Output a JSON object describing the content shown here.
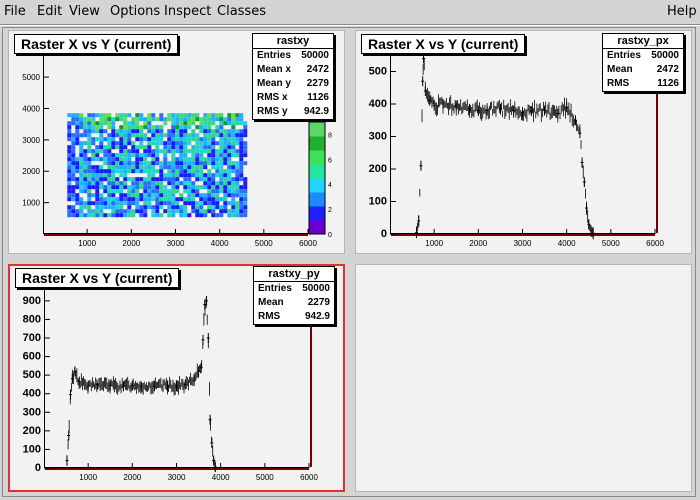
{
  "menu": {
    "file": "File",
    "edit": "Edit",
    "view": "View",
    "options": "Options",
    "inspect": "Inspect",
    "classes": "Classes",
    "help": "Help"
  },
  "colors": {
    "active_pad_border": "#e03030",
    "frame_shadow": "#7a0000",
    "pad_bg": "#f2f2f2"
  },
  "pads": {
    "p1": {
      "title": "Raster X vs Y (current)",
      "stats": {
        "name": "rastxy",
        "rows": [
          [
            "Entries",
            "50000"
          ],
          [
            "Mean x",
            "2472"
          ],
          [
            "Mean y",
            "2279"
          ],
          [
            "RMS x",
            "1126"
          ],
          [
            "RMS y",
            "942.9"
          ]
        ]
      }
    },
    "p2": {
      "title": "Raster X vs Y (current)",
      "stats": {
        "name": "rastxy_px",
        "rows": [
          [
            "Entries",
            "50000"
          ],
          [
            "Mean",
            "2472"
          ],
          [
            "RMS",
            "1126"
          ]
        ]
      }
    },
    "p3": {
      "title": "Raster X vs Y (current)",
      "stats": {
        "name": "rastxy_py",
        "rows": [
          [
            "Entries",
            "50000"
          ],
          [
            "Mean",
            "2279"
          ],
          [
            "RMS",
            "942.9"
          ]
        ]
      }
    }
  },
  "chart_data": [
    {
      "type": "heatmap",
      "title": "Raster X vs Y (current)",
      "x_ticks": [
        "1000",
        "2000",
        "3000",
        "4000",
        "5000",
        "6000"
      ],
      "y_ticks": [
        "1000",
        "2000",
        "3000",
        "4000",
        "5000"
      ],
      "xlim": [
        0,
        6000
      ],
      "ylim": [
        0,
        5800
      ],
      "filled_region": {
        "x": [
          550,
          4600
        ],
        "y": [
          600,
          3850
        ]
      },
      "color_scale": {
        "ticks": [
          "0",
          "2",
          "4",
          "6",
          "8"
        ],
        "max": 9
      }
    },
    {
      "type": "scatter",
      "title": "Raster X vs Y (current)",
      "x_ticks": [
        "1000",
        "2000",
        "3000",
        "4000",
        "5000",
        "6000"
      ],
      "y_ticks": [
        "0",
        "100",
        "200",
        "300",
        "400",
        "500"
      ],
      "xlim": [
        0,
        6000
      ],
      "ylim": [
        0,
        560
      ],
      "x": [
        600,
        650,
        700,
        740,
        760,
        800,
        900,
        1000,
        1200,
        1500,
        1800,
        2000,
        2200,
        2500,
        2800,
        3000,
        3200,
        3500,
        3800,
        4000,
        4200,
        4300,
        4350,
        4400,
        4450,
        4500,
        4550,
        4600
      ],
      "y": [
        5,
        40,
        210,
        470,
        540,
        440,
        410,
        395,
        400,
        395,
        385,
        380,
        380,
        385,
        380,
        375,
        378,
        380,
        370,
        390,
        350,
        310,
        220,
        160,
        80,
        30,
        10,
        2
      ]
    },
    {
      "type": "scatter",
      "title": "Raster X vs Y (current)",
      "x_ticks": [
        "1000",
        "2000",
        "3000",
        "4000",
        "5000",
        "6000"
      ],
      "y_ticks": [
        "0",
        "100",
        "200",
        "300",
        "400",
        "500",
        "600",
        "700",
        "800",
        "900"
      ],
      "xlim": [
        0,
        6000
      ],
      "ylim": [
        0,
        980
      ],
      "x": [
        520,
        560,
        600,
        640,
        700,
        800,
        1000,
        1200,
        1500,
        1800,
        2000,
        2200,
        2500,
        2800,
        3000,
        3200,
        3400,
        3500,
        3560,
        3600,
        3640,
        3680,
        3720,
        3760,
        3800,
        3840,
        3880
      ],
      "y": [
        40,
        175,
        395,
        480,
        520,
        465,
        440,
        450,
        445,
        440,
        445,
        440,
        440,
        445,
        440,
        450,
        470,
        520,
        540,
        690,
        880,
        900,
        700,
        260,
        135,
        40,
        5
      ]
    }
  ]
}
